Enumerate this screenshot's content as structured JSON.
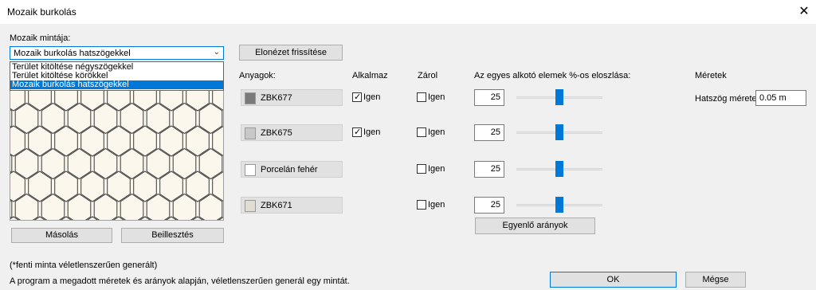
{
  "window": {
    "title": "Mozaik burkolás",
    "close_icon": "close-icon"
  },
  "pattern": {
    "label": "Mozaik mintája:",
    "selected": "Mozaik burkolás hatszögekkel",
    "options": [
      "Terület kitöltése négyszögekkel",
      "Terület kitöltése körökkel",
      "Mozaik burkolás hatszögekkel"
    ]
  },
  "buttons": {
    "refresh": "Elonézet frissítése",
    "copy": "Másolás",
    "paste": "Beillesztés",
    "equalize": "Egyenlő arányok",
    "ok": "OK",
    "cancel": "Mégse"
  },
  "columns": {
    "materials": "Anyagok:",
    "apply": "Alkalmaz",
    "lock": "Zárol",
    "distribution": "Az egyes alkotó elemek %-os eloszlása:",
    "sizes": "Méretek"
  },
  "materials": [
    {
      "name": "ZBK677",
      "color": "#7a7a7a",
      "apply_checked": true,
      "lock_checked": false,
      "percent": "25",
      "slider": 0.5
    },
    {
      "name": "ZBK675",
      "color": "#c8c8c8",
      "apply_checked": true,
      "lock_checked": false,
      "percent": "25",
      "slider": 0.5
    },
    {
      "name": "Porcelán fehér",
      "color": "#ffffff",
      "apply_checked": false,
      "lock_checked": false,
      "percent": "25",
      "slider": 0.5
    },
    {
      "name": "ZBK671",
      "color": "#e0ddd2",
      "apply_checked": false,
      "lock_checked": false,
      "percent": "25",
      "slider": 0.5
    }
  ],
  "yes_label": "Igen",
  "sizes": {
    "hex_label": "Hatszög mérete:",
    "hex_value": "0.05 m"
  },
  "notes": {
    "random_note": "(*fenti minta véletlenszerűen generált)",
    "description": "A program a megadott méretek és arányok alapján, véletlenszerűen generál egy mintát."
  }
}
